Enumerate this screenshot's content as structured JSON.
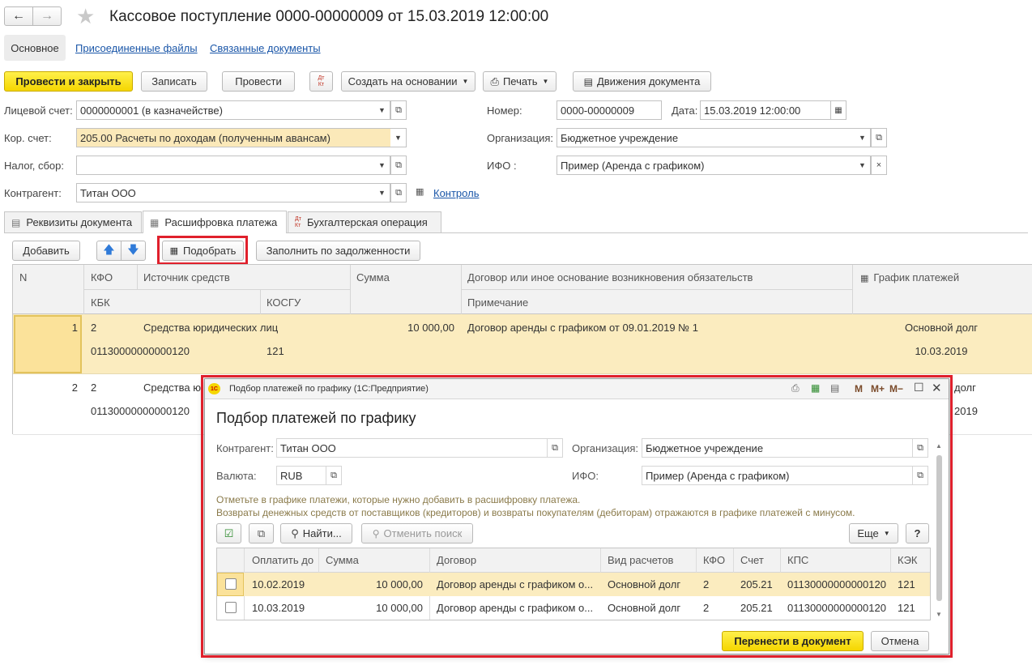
{
  "window": {
    "title": "Кассовое поступление 0000-00000009 от 15.03.2019 12:00:00"
  },
  "nav_tabs": [
    "Основное",
    "Присоединенные файлы",
    "Связанные документы"
  ],
  "toolbar": {
    "post_close": "Провести и закрыть",
    "save": "Записать",
    "post": "Провести",
    "dt_kt": "Дт Кт",
    "create_based": "Создать на основании",
    "print": "Печать",
    "movements": "Движения документа"
  },
  "form": {
    "account_label": "Лицевой счет:",
    "account_value": "0000000001 (в казначействе)",
    "kor_label": "Кор. счет:",
    "kor_value": "205.00 Расчеты по доходам (полученным авансам)",
    "tax_label": "Налог, сбор:",
    "tax_value": "",
    "counterparty_label": "Контрагент:",
    "counterparty_value": "Титан ООО",
    "control_link": "Контроль",
    "number_label": "Номер:",
    "number_value": "0000-00000009",
    "date_label": "Дата:",
    "date_value": "15.03.2019 12:00:00",
    "org_label": "Организация:",
    "org_value": "Бюджетное учреждение",
    "ifo_label": "ИФО :",
    "ifo_value": "Пример (Аренда с графиком)"
  },
  "doc_tabs": [
    "Реквизиты документа",
    "Расшифровка платежа",
    "Бухгалтерская операция"
  ],
  "table_toolbar": {
    "add": "Добавить",
    "select": "Подобрать",
    "fill_debt": "Заполнить по задолженности"
  },
  "table": {
    "headers": {
      "n": "N",
      "kfo": "КФО",
      "source": "Источник средств",
      "sum": "Сумма",
      "contract": "Договор или иное основание возникновения обязательств",
      "schedule": "График платежей",
      "kbk": "КБК",
      "kosgu": "КОСГУ",
      "note": "Примечание"
    },
    "rows": [
      {
        "n": "1",
        "kfo": "2",
        "source": "Средства юридических лиц",
        "sum": "10 000,00",
        "contract": "Договор аренды с графиком от 09.01.2019 № 1",
        "schedule": "Основной долг",
        "kbk": "01130000000000120",
        "kosgu": "121",
        "date": "10.03.2019"
      },
      {
        "n": "2",
        "kfo": "2",
        "source": "Средства ю",
        "sum": "",
        "contract": "",
        "schedule": "долг",
        "kbk": "01130000000000120",
        "kosgu": "",
        "date": "2019"
      }
    ]
  },
  "dialog": {
    "titlebar": "Подбор платежей по графику  (1С:Предприятие)",
    "heading": "Подбор платежей по графику",
    "counterparty_label": "Контрагент:",
    "counterparty_value": "Титан ООО",
    "org_label": "Организация:",
    "org_value": "Бюджетное учреждение",
    "currency_label": "Валюта:",
    "currency_value": "RUB",
    "ifo_label": "ИФО:",
    "ifo_value": "Пример (Аренда с графиком)",
    "hint1": "Отметьте в графике платежи, которые нужно добавить в расшифровку платежа.",
    "hint2": "Возвраты денежных средств от поставщиков (кредиторов) и возвраты покупателям (дебиторам) отражаются в графике платежей с минусом.",
    "find": "Найти...",
    "cancel_search": "Отменить поиск",
    "more": "Еще",
    "help": "?",
    "titlebar_m": "M",
    "titlebar_mplus": "M+",
    "titlebar_mminus": "M−",
    "columns": [
      "Оплатить до",
      "Сумма",
      "Договор",
      "Вид расчетов",
      "КФО",
      "Счет",
      "КПС",
      "КЭК"
    ],
    "rows": [
      {
        "due": "10.02.2019",
        "sum": "10 000,00",
        "contract": "Договор аренды с графиком о...",
        "kind": "Основной долг",
        "kfo": "2",
        "account": "205.21",
        "kps": "01130000000000120",
        "kek": "121"
      },
      {
        "due": "10.03.2019",
        "sum": "10 000,00",
        "contract": "Договор аренды с графиком о...",
        "kind": "Основной долг",
        "kfo": "2",
        "account": "205.21",
        "kps": "01130000000000120",
        "kek": "121"
      }
    ],
    "transfer": "Перенести в документ",
    "cancel": "Отмена"
  },
  "colors": {
    "accent_yellow": "#f5d600",
    "selection": "#fbe9b9",
    "highlight_red": "#e0202c",
    "link": "#1a56a8"
  }
}
